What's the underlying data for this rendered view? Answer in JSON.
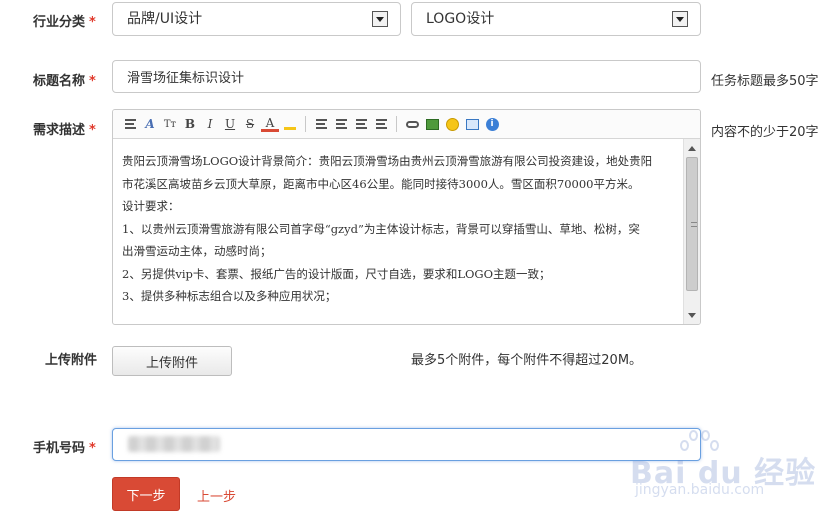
{
  "form": {
    "industry": {
      "label": "行业分类",
      "required_mark": "*",
      "primary_value": "品牌/UI设计",
      "secondary_value": "LOGO设计"
    },
    "title": {
      "label": "标题名称",
      "required_mark": "*",
      "value": "滑雪场征集标识设计",
      "hint": "任务标题最多50字"
    },
    "description": {
      "label": "需求描述",
      "required_mark": "*",
      "hint": "内容不的少于20字",
      "toolbar_icons": [
        "paragraph-icon",
        "font-family-icon",
        "font-size-icon",
        "bold-icon",
        "italic-icon",
        "underline-icon",
        "strikethrough-icon",
        "font-color-icon",
        "highlight-icon",
        "align-icon",
        "list-icon",
        "indent-icon",
        "outdent-icon",
        "link-icon",
        "image-icon",
        "emoticon-icon",
        "media-icon",
        "info-icon"
      ],
      "toolbar_glyphs": {
        "font_family": "A",
        "font_size": "Tт",
        "bold": "B",
        "italic": "I",
        "underline": "U",
        "strike": "S",
        "font_color": "A",
        "info": "i"
      },
      "lines": [
        "贵阳云顶滑雪场LOGO设计背景简介：贵阳云顶滑雪场由贵州云顶滑雪旅游有限公司投资建设，地处贵阳",
        "市花溪区高坡苗乡云顶大草原，距离市中心区46公里。能同时接待3000人。雪区面积70000平方米。",
        "设计要求：",
        "1、以贵州云顶滑雪旅游有限公司首字母“gzyd”为主体设计标志，背景可以穿插雪山、草地、松树，突",
        "出滑雪运动主体，动感时尚；",
        "2、另提供vip卡、套票、报纸广告的设计版面，尺寸自选，要求和LOGO主题一致；",
        "3、提供多种标志组合以及多种应用状况；"
      ]
    },
    "attachment": {
      "label": "上传附件",
      "button_label": "上传附件",
      "hint": "最多5个附件，每个附件不得超过20M。"
    },
    "phone": {
      "label": "手机号码",
      "required_mark": "*",
      "value": ""
    },
    "actions": {
      "next_label": "下一步",
      "prev_label": "上一步"
    }
  },
  "watermark": {
    "brand": "Bai du 经验",
    "url": "jingyan.baidu.com"
  },
  "colors": {
    "accent": "#d94a35",
    "required": "#e0382a",
    "border": "#c9c9c9",
    "focus_border": "#6aa0e0"
  }
}
